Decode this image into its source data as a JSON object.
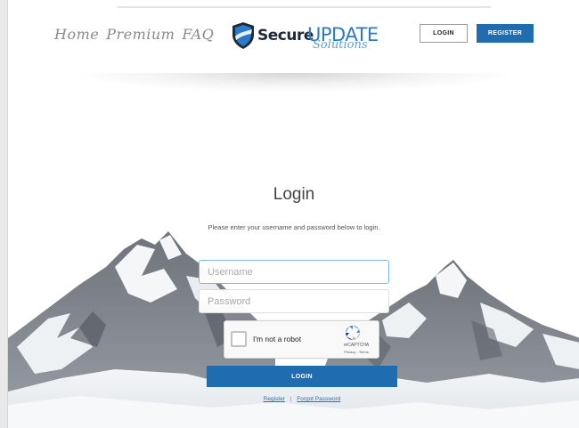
{
  "nav": {
    "home": "Home",
    "premium": "Premium",
    "faq": "FAQ"
  },
  "logo": {
    "secure": "Secure",
    "update": "UPDATE",
    "solutions": "Solutions"
  },
  "header_buttons": {
    "login": "LOGIN",
    "register": "REGISTER"
  },
  "form": {
    "title": "Login",
    "description": "Please enter your username and password below to login.",
    "username_placeholder": "Username",
    "password_placeholder": "Password",
    "submit": "LOGIN"
  },
  "captcha": {
    "label": "I'm not a robot",
    "brand": "reCAPTCHA",
    "terms": "Privacy - Terms"
  },
  "links": {
    "register": "Register",
    "separator": "|",
    "forgot": "Forgot Password"
  },
  "colors": {
    "primary": "#1f6cb0",
    "logo_blue": "#2b7ac9",
    "logo_dark": "#1e2a3a",
    "nav_gray": "#8a8a8a"
  }
}
